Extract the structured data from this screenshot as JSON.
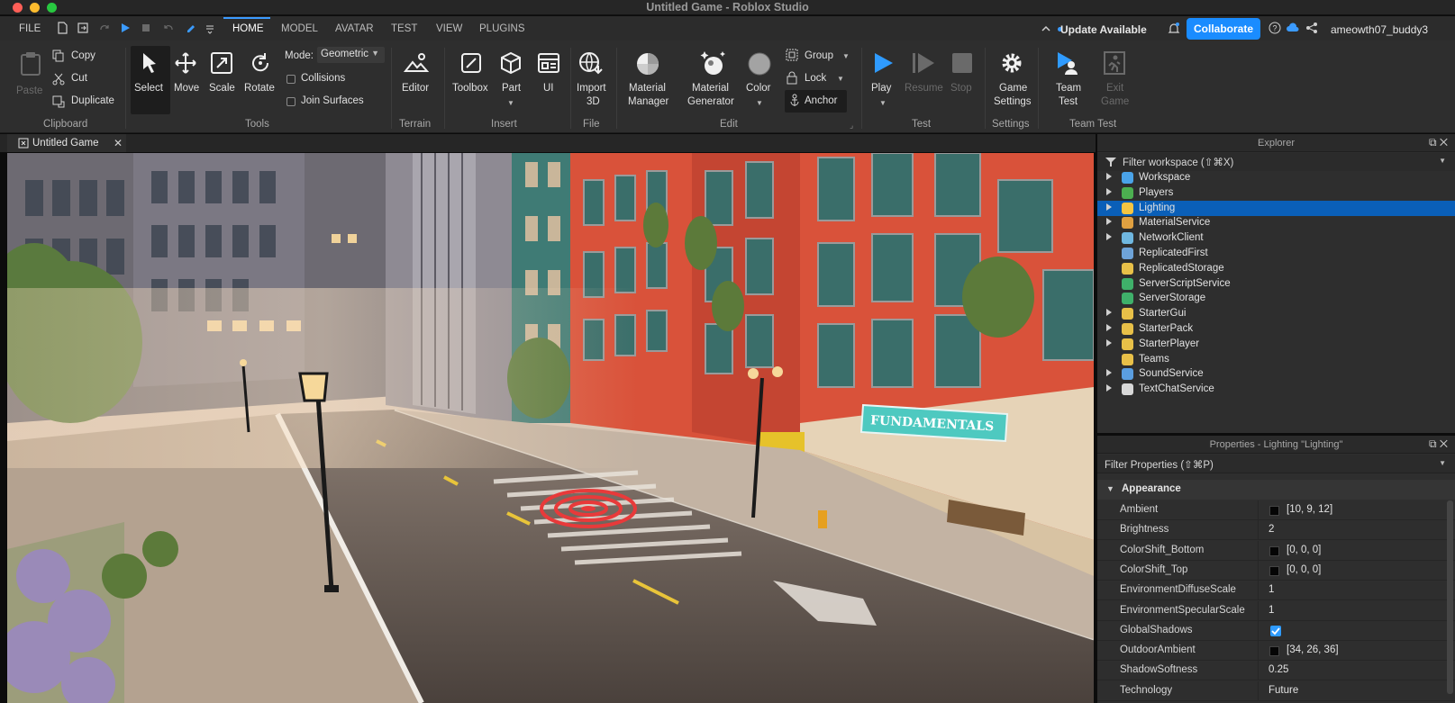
{
  "window": {
    "title": "Untitled Game - Roblox Studio"
  },
  "menubar": {
    "file": "FILE",
    "tabs": [
      "HOME",
      "MODEL",
      "AVATAR",
      "TEST",
      "VIEW",
      "PLUGINS"
    ],
    "active_tab": "HOME",
    "update": "Update Available",
    "collaborate": "Collaborate",
    "username": "ameowth07_buddy3"
  },
  "ribbon": {
    "clipboard": {
      "paste": "Paste",
      "copy": "Copy",
      "cut": "Cut",
      "duplicate": "Duplicate",
      "group": "Clipboard"
    },
    "tools": {
      "select": "Select",
      "move": "Move",
      "scale": "Scale",
      "rotate": "Rotate",
      "mode_label": "Mode:",
      "mode_value": "Geometric",
      "collisions": "Collisions",
      "join_surfaces": "Join Surfaces",
      "group": "Tools"
    },
    "terrain": {
      "editor": "Editor",
      "group": "Terrain"
    },
    "insert": {
      "toolbox": "Toolbox",
      "part": "Part",
      "ui": "UI",
      "group": "Insert"
    },
    "file": {
      "import_l1": "Import",
      "import_l2": "3D",
      "group": "File"
    },
    "edit": {
      "mm_l1": "Material",
      "mm_l2": "Manager",
      "mg_l1": "Material",
      "mg_l2": "Generator",
      "color": "Color",
      "group_btn": "Group",
      "lock": "Lock",
      "anchor": "Anchor",
      "group": "Edit"
    },
    "test": {
      "play": "Play",
      "resume": "Resume",
      "stop": "Stop",
      "group": "Test"
    },
    "settings": {
      "gs_l1": "Game",
      "gs_l2": "Settings",
      "group": "Settings"
    },
    "team_test": {
      "tt_l1": "Team",
      "tt_l2": "Test",
      "exit_l1": "Exit",
      "exit_l2": "Game",
      "group": "Team Test"
    }
  },
  "document_tab": {
    "label": "Untitled Game"
  },
  "explorer": {
    "title": "Explorer",
    "filter": "Filter workspace (⇧⌘X)",
    "items": [
      {
        "label": "Workspace",
        "expandable": true,
        "color": "#4aa3e8"
      },
      {
        "label": "Players",
        "expandable": true,
        "color": "#4caf50"
      },
      {
        "label": "Lighting",
        "expandable": true,
        "color": "#f5c542",
        "selected": true
      },
      {
        "label": "MaterialService",
        "expandable": true,
        "color": "#e0a040"
      },
      {
        "label": "NetworkClient",
        "expandable": true,
        "color": "#6fb7e0"
      },
      {
        "label": "ReplicatedFirst",
        "expandable": false,
        "color": "#6ea3d8"
      },
      {
        "label": "ReplicatedStorage",
        "expandable": false,
        "color": "#e8c048"
      },
      {
        "label": "ServerScriptService",
        "expandable": false,
        "color": "#3fb06a"
      },
      {
        "label": "ServerStorage",
        "expandable": false,
        "color": "#3fb06a"
      },
      {
        "label": "StarterGui",
        "expandable": true,
        "color": "#e8c048"
      },
      {
        "label": "StarterPack",
        "expandable": true,
        "color": "#e8c048"
      },
      {
        "label": "StarterPlayer",
        "expandable": true,
        "color": "#e8c048"
      },
      {
        "label": "Teams",
        "expandable": false,
        "color": "#e8c048"
      },
      {
        "label": "SoundService",
        "expandable": true,
        "color": "#5a9ee0"
      },
      {
        "label": "TextChatService",
        "expandable": true,
        "color": "#d8d8d8"
      }
    ]
  },
  "properties": {
    "title": "Properties - Lighting \"Lighting\"",
    "filter": "Filter Properties (⇧⌘P)",
    "section": "Appearance",
    "rows": [
      {
        "name": "Ambient",
        "value": "[10, 9, 12]",
        "swatch": true
      },
      {
        "name": "Brightness",
        "value": "2"
      },
      {
        "name": "ColorShift_Bottom",
        "value": "[0, 0, 0]",
        "swatch": true
      },
      {
        "name": "ColorShift_Top",
        "value": "[0, 0, 0]",
        "swatch": true
      },
      {
        "name": "EnvironmentDiffuseScale",
        "value": "1"
      },
      {
        "name": "EnvironmentSpecularScale",
        "value": "1"
      },
      {
        "name": "GlobalShadows",
        "value": "",
        "checkbox": true
      },
      {
        "name": "OutdoorAmbient",
        "value": "[34, 26, 36]",
        "swatch": true
      },
      {
        "name": "ShadowSoftness",
        "value": "0.25"
      },
      {
        "name": "Technology",
        "value": "Future"
      }
    ]
  },
  "scene": {
    "sign": "FUNDAMENTALS"
  },
  "colors": {
    "accent": "#1a8cff",
    "selection": "#0a5fb8",
    "brick": "#d9523a",
    "sign_teal": "#4ec9c0"
  }
}
